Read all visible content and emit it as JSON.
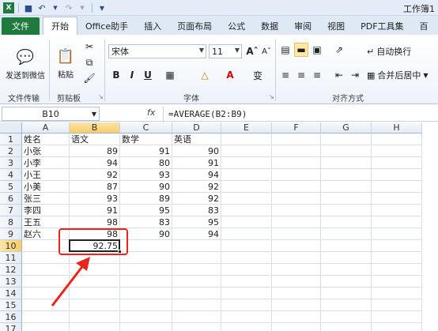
{
  "window": {
    "title": "工作簿1"
  },
  "qat": {
    "icons": [
      "excel-icon",
      "save-icon",
      "undo-icon",
      "redo-icon",
      "customize-icon"
    ]
  },
  "tabs": [
    "文件",
    "开始",
    "Office助手",
    "插入",
    "页面布局",
    "公式",
    "数据",
    "审阅",
    "视图",
    "PDF工具集",
    "百"
  ],
  "ribbon": {
    "groups": {
      "file_transfer": "文件传输",
      "clipboard": "剪贴板",
      "font": "字体",
      "alignment": "对齐方式"
    },
    "send_wechat": "发送到微信",
    "paste": "粘贴",
    "font_name": "宋体",
    "font_size": "11",
    "bold": "B",
    "italic": "I",
    "underline": "U",
    "wen": "变",
    "wrap_text": "自动换行",
    "merge_center": "合并后居中"
  },
  "formula_bar": {
    "name_box": "B10",
    "fx": "fx",
    "formula": "=AVERAGE(B2:B9)"
  },
  "sheet": {
    "columns": [
      "A",
      "B",
      "C",
      "D",
      "E",
      "F",
      "G",
      "H"
    ],
    "rows": [
      "1",
      "2",
      "3",
      "4",
      "5",
      "6",
      "7",
      "8",
      "9",
      "10",
      "11",
      "12",
      "13",
      "14",
      "15",
      "16",
      "17"
    ],
    "header_row": [
      "姓名",
      "语文",
      "数学",
      "英语"
    ],
    "data": [
      [
        "小张",
        "89",
        "91",
        "90"
      ],
      [
        "小李",
        "94",
        "80",
        "91"
      ],
      [
        "小王",
        "92",
        "93",
        "94"
      ],
      [
        "小美",
        "87",
        "90",
        "92"
      ],
      [
        "张三",
        "93",
        "89",
        "92"
      ],
      [
        "李四",
        "91",
        "95",
        "83"
      ],
      [
        "王五",
        "98",
        "83",
        "95"
      ],
      [
        "赵六",
        "98",
        "90",
        "94"
      ]
    ],
    "result": "92.75"
  }
}
